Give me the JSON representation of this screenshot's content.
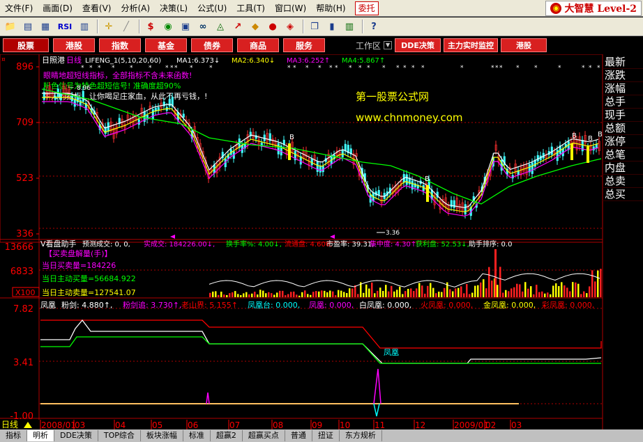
{
  "menu": {
    "items": [
      "文件(F)",
      "画面(D)",
      "查看(V)",
      "分析(A)",
      "决策(L)",
      "公式(U)",
      "工具(T)",
      "窗口(W)",
      "帮助(H)"
    ],
    "trade_label": "委托",
    "brand": "大智慧 Level-2"
  },
  "toolbar": {
    "icons": [
      "folder-icon",
      "chart-icon",
      "grid-icon",
      "rsi-icon",
      "kline-icon",
      "move-icon",
      "ruler-icon",
      "dollar-icon",
      "eye-icon",
      "plate-icon",
      "binoculars-icon",
      "bell-icon",
      "chart-up-icon",
      "diamond-icon",
      "circle-icon",
      "tag-icon",
      "copy-icon",
      "bars-icon",
      "books-icon",
      "help-icon"
    ],
    "rsi_label": "RSI"
  },
  "navbar": {
    "buttons": [
      "股票",
      "港股",
      "指数",
      "基金",
      "债券",
      "商品",
      "服务"
    ],
    "workspace_label": "工作区",
    "right_buttons": [
      "DDE决策",
      "主力实时监控",
      "港股"
    ]
  },
  "right_panel": {
    "items": [
      "最新",
      "涨跌",
      "涨幅",
      "总手",
      "现手",
      "总额",
      "涨停",
      "总笔",
      "内盘",
      "总卖",
      "总买"
    ]
  },
  "main_pane": {
    "stock": "日照港",
    "period": "日线",
    "indicator": "LIFENG_1(5,10,20,60)",
    "ma": [
      {
        "label": "MA1:",
        "value": "6.373",
        "dir": "↓",
        "color": "#ffffff"
      },
      {
        "label": "MA2:",
        "value": "6.340",
        "dir": "↓",
        "color": "#ffff00"
      },
      {
        "label": "MA3:",
        "value": "6.252",
        "dir": "↑",
        "color": "#ff00ff"
      },
      {
        "label": "MA4:",
        "value": "5.867",
        "dir": "↑",
        "color": "#00ff00"
      }
    ],
    "notes": [
      {
        "text": "眼睛地超短线指标，全部指标不含未来函数!",
        "color": "#ff00ff"
      },
      {
        "text": "粉色信号为特色超短信号! 准确度超90%",
        "color": "#00ff00"
      },
      {
        "text": "牛人的指标，让你喝足庄家血，从此不再亏钱，!",
        "color": "#ffffff"
      }
    ],
    "watermark_title": "第一股票公式网",
    "watermark_url": "www.chnmoney.com",
    "y_labels": [
      "896",
      "709",
      "523",
      "336"
    ],
    "high_label": "8.96",
    "low_label": "3.36",
    "buy_mark": "B"
  },
  "volume_pane": {
    "indicator": "V看盘助手",
    "header": [
      {
        "text": "预测成交: 0, 0,",
        "color": "#ffffff"
      },
      {
        "text": "实成交: 184226.00↓,",
        "color": "#ff00ff"
      },
      {
        "text": "换手率%: 4.00↓,",
        "color": "#00ff00"
      },
      {
        "text": "流通盘: 4.606,",
        "color": "#ff0000"
      },
      {
        "text": "市盈率: 39.31,",
        "color": "#ffffff"
      },
      {
        "text": "集中度: 4.30↑,",
        "color": "#ff00ff"
      },
      {
        "text": "获利盘: 52.53↓,",
        "color": "#00ff00"
      },
      {
        "text": "助手排序: 0.0",
        "color": "#ffffff"
      }
    ],
    "subtitle": "【买卖盘解量(手)】",
    "today_vol": "当日买卖量=184226",
    "today_active": "当日主动买量=56684.922",
    "today_passive": "当日主动卖量=127541.07",
    "y_labels": [
      "13666",
      "6833"
    ],
    "scale": "X100"
  },
  "phoenix_pane": {
    "indicator": "凤凰",
    "header": [
      {
        "text": "粉剑: 4.880↑,",
        "color": "#ffffff"
      },
      {
        "text": "粉剑追: 3.730↑,",
        "color": "#ff00ff"
      },
      {
        "text": "老山界: 5.155↑",
        "color": "#ff0000"
      },
      {
        "text": "凤凰台: 0.000,",
        "color": "#00ffff"
      },
      {
        "text": "凤凰: 0.000,",
        "color": "#ff00ff"
      },
      {
        "text": "白凤凰: 0.000,",
        "color": "#ffffff"
      },
      {
        "text": "火凤凰: 0.000,",
        "color": "#ff0000"
      },
      {
        "text": "金凤凰: 0.000,",
        "color": "#ffff00"
      },
      {
        "text": "彩凤凰: 0.000,",
        "color": "#ff0000"
      }
    ],
    "y_labels": [
      "7.82",
      "3.41",
      "-1.00"
    ],
    "line_label": "凤凰"
  },
  "xaxis": {
    "period_label": "日线",
    "labels": [
      "2008/01",
      "03",
      "04",
      "05",
      "06",
      "07",
      "08",
      "09",
      "10",
      "11",
      "12",
      "2009/01",
      "02",
      "03"
    ]
  },
  "bottom_tabs": [
    "指标",
    "明析",
    "DDE决策",
    "TOP综合",
    "板块涨幅",
    "标准",
    "超赢2",
    "超赢买点",
    "普通",
    "扭证",
    "东方规析"
  ],
  "colors": {
    "grid_red": "#b00000",
    "axis_red": "#ff0000",
    "nav_red": "#d82020"
  }
}
